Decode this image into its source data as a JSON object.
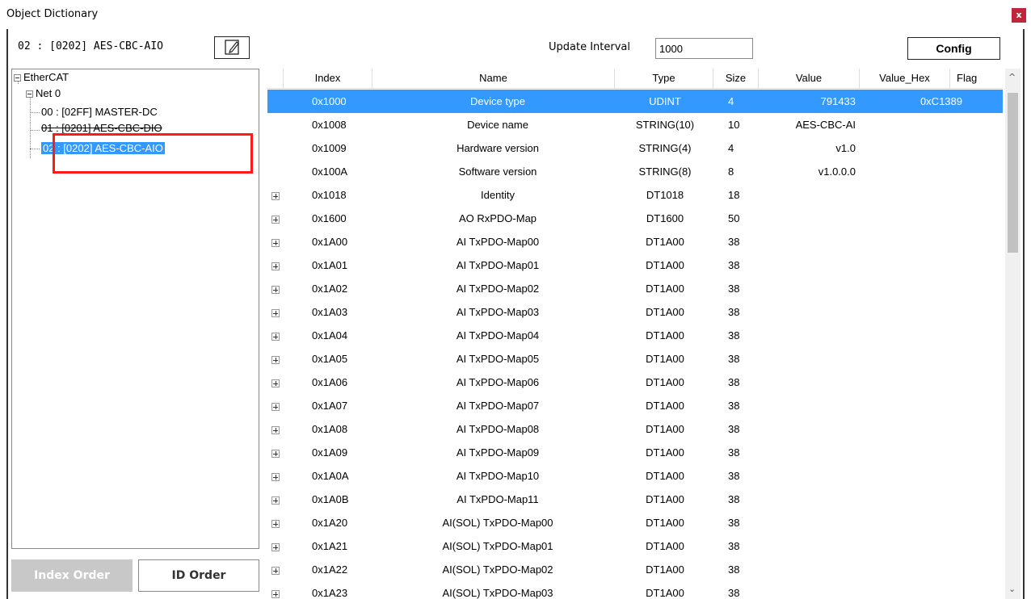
{
  "window": {
    "title": "Object Dictionary",
    "close_label": "x"
  },
  "toolbar": {
    "device_label": "02 : [0202] AES-CBC-AIO",
    "update_interval_label": "Update Interval",
    "update_interval_value": "1000",
    "config_label": "Config"
  },
  "tree": {
    "root": "EtherCAT",
    "net": "Net 0",
    "nodes": [
      "00 : [02FF] MASTER-DC",
      "01 : [0201] AES-CBC-DIO",
      "02 : [0202] AES-CBC-AIO"
    ],
    "selected_index": 2
  },
  "buttons": {
    "index_order": "Index Order",
    "id_order": "ID Order"
  },
  "table": {
    "columns": [
      "Index",
      "Name",
      "Type",
      "Size",
      "Value",
      "Value_Hex",
      "Flag"
    ],
    "rows": [
      {
        "expand": false,
        "index": "0x1000",
        "name": "Device type",
        "type": "UDINT",
        "size": "4",
        "value": "791433",
        "hex": "0xC1389",
        "selected": true
      },
      {
        "expand": false,
        "index": "0x1008",
        "name": "Device name",
        "type": "STRING(10)",
        "size": "10",
        "value": "AES-CBC-AI",
        "hex": ""
      },
      {
        "expand": false,
        "index": "0x1009",
        "name": "Hardware version",
        "type": "STRING(4)",
        "size": "4",
        "value": "v1.0",
        "hex": ""
      },
      {
        "expand": false,
        "index": "0x100A",
        "name": "Software version",
        "type": "STRING(8)",
        "size": "8",
        "value": "v1.0.0.0",
        "hex": ""
      },
      {
        "expand": true,
        "index": "0x1018",
        "name": "Identity",
        "type": "DT1018",
        "size": "18",
        "value": "",
        "hex": ""
      },
      {
        "expand": true,
        "index": "0x1600",
        "name": "AO RxPDO-Map",
        "type": "DT1600",
        "size": "50",
        "value": "",
        "hex": ""
      },
      {
        "expand": true,
        "index": "0x1A00",
        "name": "AI TxPDO-Map00",
        "type": "DT1A00",
        "size": "38",
        "value": "",
        "hex": ""
      },
      {
        "expand": true,
        "index": "0x1A01",
        "name": "AI TxPDO-Map01",
        "type": "DT1A00",
        "size": "38",
        "value": "",
        "hex": ""
      },
      {
        "expand": true,
        "index": "0x1A02",
        "name": "AI TxPDO-Map02",
        "type": "DT1A00",
        "size": "38",
        "value": "",
        "hex": ""
      },
      {
        "expand": true,
        "index": "0x1A03",
        "name": "AI TxPDO-Map03",
        "type": "DT1A00",
        "size": "38",
        "value": "",
        "hex": ""
      },
      {
        "expand": true,
        "index": "0x1A04",
        "name": "AI TxPDO-Map04",
        "type": "DT1A00",
        "size": "38",
        "value": "",
        "hex": ""
      },
      {
        "expand": true,
        "index": "0x1A05",
        "name": "AI TxPDO-Map05",
        "type": "DT1A00",
        "size": "38",
        "value": "",
        "hex": ""
      },
      {
        "expand": true,
        "index": "0x1A06",
        "name": "AI TxPDO-Map06",
        "type": "DT1A00",
        "size": "38",
        "value": "",
        "hex": ""
      },
      {
        "expand": true,
        "index": "0x1A07",
        "name": "AI TxPDO-Map07",
        "type": "DT1A00",
        "size": "38",
        "value": "",
        "hex": ""
      },
      {
        "expand": true,
        "index": "0x1A08",
        "name": "AI TxPDO-Map08",
        "type": "DT1A00",
        "size": "38",
        "value": "",
        "hex": ""
      },
      {
        "expand": true,
        "index": "0x1A09",
        "name": "AI TxPDO-Map09",
        "type": "DT1A00",
        "size": "38",
        "value": "",
        "hex": ""
      },
      {
        "expand": true,
        "index": "0x1A0A",
        "name": "AI TxPDO-Map10",
        "type": "DT1A00",
        "size": "38",
        "value": "",
        "hex": ""
      },
      {
        "expand": true,
        "index": "0x1A0B",
        "name": "AI TxPDO-Map11",
        "type": "DT1A00",
        "size": "38",
        "value": "",
        "hex": ""
      },
      {
        "expand": true,
        "index": "0x1A20",
        "name": "AI(SOL) TxPDO-Map00",
        "type": "DT1A00",
        "size": "38",
        "value": "",
        "hex": ""
      },
      {
        "expand": true,
        "index": "0x1A21",
        "name": "AI(SOL) TxPDO-Map01",
        "type": "DT1A00",
        "size": "38",
        "value": "",
        "hex": ""
      },
      {
        "expand": true,
        "index": "0x1A22",
        "name": "AI(SOL) TxPDO-Map02",
        "type": "DT1A00",
        "size": "38",
        "value": "",
        "hex": ""
      },
      {
        "expand": true,
        "index": "0x1A23",
        "name": "AI(SOL) TxPDO-Map03",
        "type": "DT1A00",
        "size": "38",
        "value": "",
        "hex": ""
      }
    ]
  }
}
